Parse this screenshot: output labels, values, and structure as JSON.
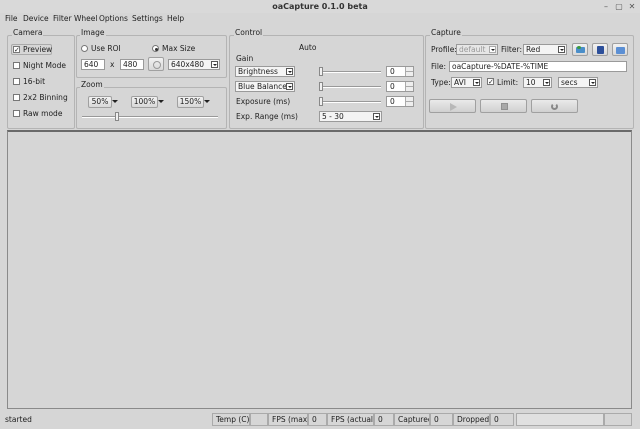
{
  "window": {
    "title": "oaCapture 0.1.0 beta",
    "minimize_glyph": "–",
    "maximize_glyph": "▢",
    "close_glyph": "✕"
  },
  "menu": [
    "File",
    "Device",
    "Filter Wheel",
    "Options",
    "Settings",
    "Help"
  ],
  "camera": {
    "title": "Camera",
    "options": [
      {
        "label": "Preview",
        "checked": true
      },
      {
        "label": "Night Mode",
        "checked": false
      },
      {
        "label": "16-bit",
        "checked": false
      },
      {
        "label": "2x2 Binning",
        "checked": false
      },
      {
        "label": "Raw mode",
        "checked": false
      }
    ]
  },
  "image": {
    "title": "Image",
    "use_roi_label": "Use ROI",
    "max_size_label": "Max Size",
    "selected_mode": "Max Size",
    "width": "640",
    "x_label": "x",
    "height": "480",
    "resolution": "640x480"
  },
  "zoom": {
    "title": "Zoom",
    "presets": [
      "50%",
      "100%",
      "150%"
    ],
    "level_fraction": 0.25
  },
  "control": {
    "title": "Control",
    "auto_label": "Auto",
    "gain_label": "Gain",
    "rows": [
      {
        "name": "Brightness",
        "value": "0",
        "level_fraction": 0.0
      },
      {
        "name": "Blue Balance",
        "value": "0",
        "level_fraction": 0.0
      },
      {
        "name": "Exposure (ms)",
        "value": "0",
        "level_fraction": 0.0
      }
    ],
    "gain_level_fraction": 0.0,
    "exp_range_label": "Exp. Range (ms)",
    "exp_range_value": "5 - 30"
  },
  "capture": {
    "title": "Capture",
    "profile_label": "Profile:",
    "profile_value": "default",
    "filter_label": "Filter:",
    "filter_value": "Red",
    "file_label": "File:",
    "file_value": "oaCapture-%DATE-%TIME",
    "type_label": "Type:",
    "type_value": "AVI",
    "limit_label": "Limit:",
    "limit_checked": true,
    "limit_value": "10",
    "limit_unit": "secs"
  },
  "status": {
    "message": "started",
    "temp_label": "Temp (C)",
    "temp_value": "",
    "fps_max_label": "FPS (max)",
    "fps_max_value": "0",
    "fps_actual_label": "FPS (actual)",
    "fps_actual_value": "0",
    "captured_label": "Captured",
    "captured_value": "0",
    "dropped_label": "Dropped",
    "dropped_value": "0"
  },
  "colors": {
    "window_bg": "#d6d6d6",
    "accent_blue": "#3a6fc4",
    "icon_green": "#3c9a3c"
  }
}
